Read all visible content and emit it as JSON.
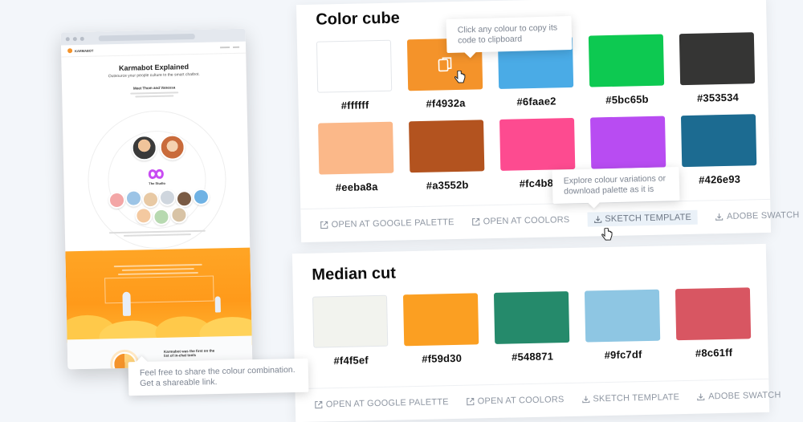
{
  "preview": {
    "nav_logo": "KARMABOT",
    "title": "Karmabot Explained",
    "subtitle": "Outsource your people culture to the smart chatbot.",
    "section_title": "Meet Thom and Vanessa",
    "studio_label": "The Studio",
    "footer_title": "Karmabot was the first on the list of in-chat tools"
  },
  "tooltips": {
    "copy": "Click any colour to copy its code to clipboard",
    "explore": "Explore colour variations or download palette as it is",
    "share": "Feel free to share the colour combination. Get a shareable link."
  },
  "palettes": [
    {
      "title": "Color cube",
      "swatches": [
        {
          "hex": "#ffffff",
          "color": "#ffffff"
        },
        {
          "hex": "#f4932a",
          "color": "#f4932a"
        },
        {
          "hex": "#6faae2",
          "color": "#4aabe6"
        },
        {
          "hex": "#5bc65b",
          "color": "#0dc951"
        },
        {
          "hex": "#353534",
          "color": "#353534"
        },
        {
          "hex": "#eeba8a",
          "color": "#fbb889"
        },
        {
          "hex": "#a3552b",
          "color": "#b3531f"
        },
        {
          "hex": "#fc4b8f",
          "color": "#fd4b90"
        },
        {
          "hex": "#cb54f5",
          "color": "#b84cf2"
        },
        {
          "hex": "#426e93",
          "color": "#1c6b91"
        }
      ],
      "actions": [
        {
          "label": "OPEN AT GOOGLE PALETTE",
          "icon": "external-link-icon"
        },
        {
          "label": "OPEN AT COOLORS",
          "icon": "external-link-icon"
        },
        {
          "label": "SKETCH TEMPLATE",
          "icon": "download-icon"
        },
        {
          "label": "ADOBE SWATCH",
          "icon": "download-icon"
        }
      ]
    },
    {
      "title": "Median cut",
      "swatches": [
        {
          "hex": "#f4f5ef",
          "color": "#f2f3ee"
        },
        {
          "hex": "#f59d30",
          "color": "#fb9f22"
        },
        {
          "hex": "#548871",
          "color": "#258a6b"
        },
        {
          "hex": "#9fc7df",
          "color": "#8ec6e3"
        },
        {
          "hex": "#8c61ff",
          "color": "#d85662"
        }
      ],
      "actions": [
        {
          "label": "OPEN AT GOOGLE PALETTE",
          "icon": "external-link-icon"
        },
        {
          "label": "OPEN AT COOLORS",
          "icon": "external-link-icon"
        },
        {
          "label": "SKETCH TEMPLATE",
          "icon": "download-icon"
        },
        {
          "label": "ADOBE SWATCH",
          "icon": "download-icon"
        }
      ]
    }
  ]
}
